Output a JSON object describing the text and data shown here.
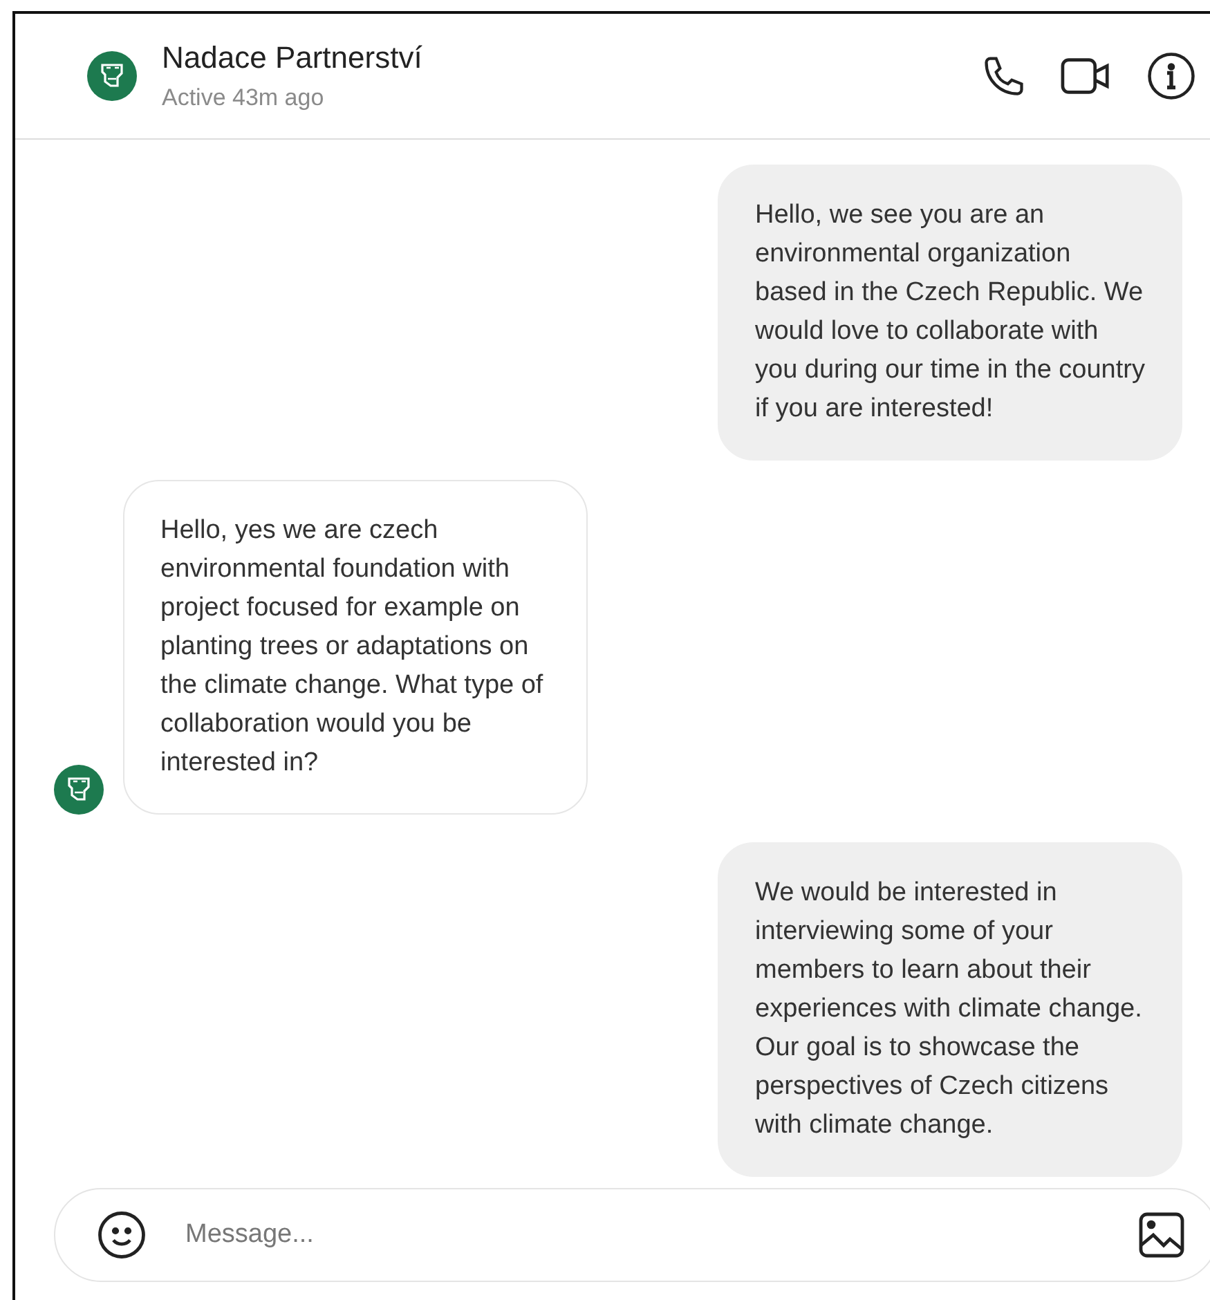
{
  "header": {
    "name": "Nadace Partnerství",
    "status": "Active 43m ago"
  },
  "messages": [
    {
      "kind": "outgoing",
      "text": "Hello, we see you are an environmental organization based in the Czech Republic. We would love to collaborate with you during our time in the country if you are interested!"
    },
    {
      "kind": "incoming",
      "text": "Hello, yes we are czech environmental foundation with project focused for example on planting trees or adaptations on the climate change. What type of collaboration would you be interested in?"
    },
    {
      "kind": "outgoing",
      "text": "We would be interested in interviewing some of your members to learn about their experiences with climate change. Our goal is to showcase the perspectives of Czech citizens with climate change."
    }
  ],
  "composer": {
    "placeholder": "Message..."
  }
}
